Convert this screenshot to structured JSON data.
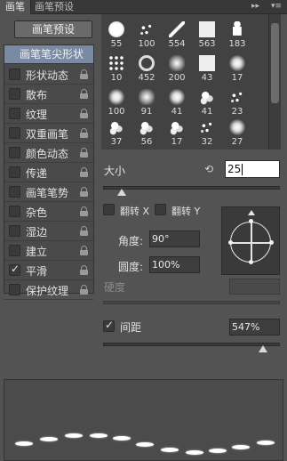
{
  "tabs": [
    {
      "label": "画笔",
      "active": true
    },
    {
      "label": "画笔预设",
      "active": false
    }
  ],
  "preset_button": "画笔预设",
  "brush_tip_header": "画笔笔尖形状",
  "options": [
    {
      "label": "形状动态",
      "checked": false,
      "locked": true
    },
    {
      "label": "散布",
      "checked": false,
      "locked": true
    },
    {
      "label": "纹理",
      "checked": false,
      "locked": true
    },
    {
      "label": "双重画笔",
      "checked": false,
      "locked": true
    },
    {
      "label": "颜色动态",
      "checked": false,
      "locked": true
    },
    {
      "label": "传递",
      "checked": false,
      "locked": true
    },
    {
      "label": "画笔笔势",
      "checked": false,
      "locked": true
    },
    {
      "label": "杂色",
      "checked": false,
      "locked": true
    },
    {
      "label": "湿边",
      "checked": false,
      "locked": true
    },
    {
      "label": "建立",
      "checked": false,
      "locked": true
    },
    {
      "label": "平滑",
      "checked": true,
      "locked": true
    },
    {
      "label": "保护纹理",
      "checked": false,
      "locked": true
    }
  ],
  "brush_grid": {
    "row0_numbers": [
      "55",
      "100",
      "554",
      "563",
      "183"
    ],
    "row1_numbers": [
      "10",
      "452",
      "200",
      "43",
      "17"
    ],
    "row2_numbers": [
      "100",
      "91",
      "41",
      "41",
      "23"
    ],
    "row3_numbers": [
      "37",
      "56",
      "17",
      "32",
      "27"
    ]
  },
  "size": {
    "label": "大小",
    "value": "25"
  },
  "flip_x": {
    "label": "翻转 X",
    "checked": false
  },
  "flip_y": {
    "label": "翻转 Y",
    "checked": false
  },
  "angle": {
    "label": "角度:",
    "value": "90°"
  },
  "roundness": {
    "label": "圆度:",
    "value": "100%"
  },
  "hardness": {
    "label": "硬度"
  },
  "spacing": {
    "label": "间距",
    "checked": true,
    "value": "547%"
  },
  "sliders": {
    "size_fraction": 0.1,
    "spacing_fraction": 0.9
  },
  "icons": [
    "reset-size-icon",
    "lock-icon",
    "panel-menu-icon",
    "collapse-icon"
  ]
}
